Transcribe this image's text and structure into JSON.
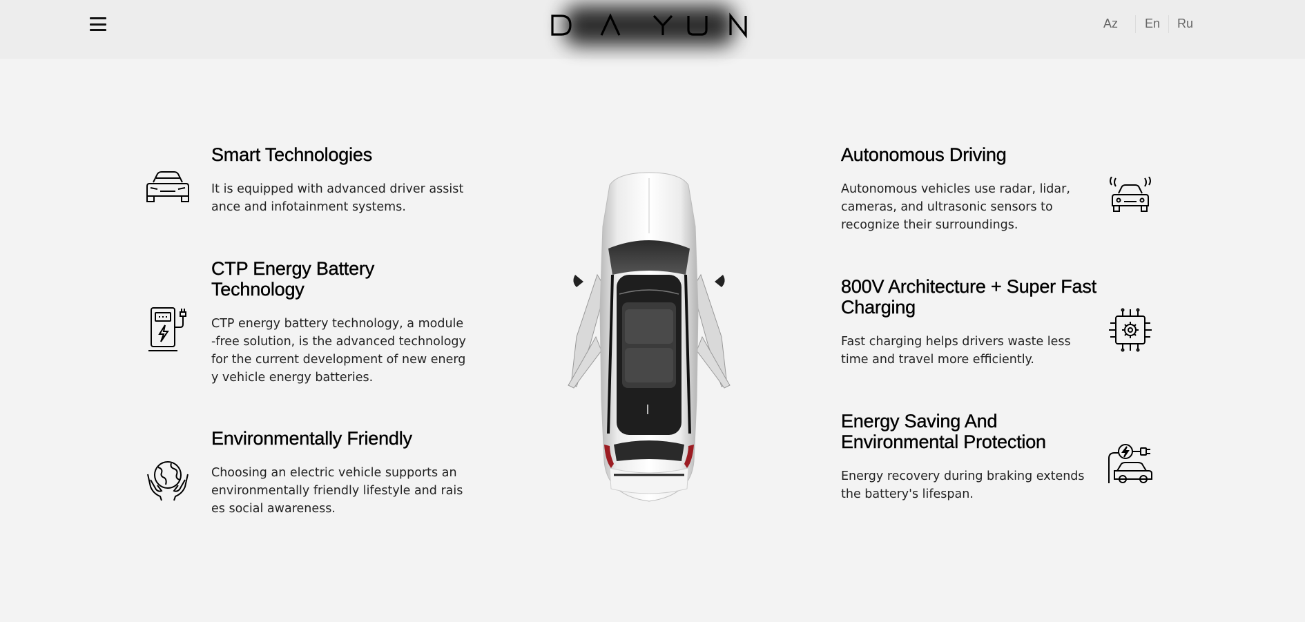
{
  "header": {
    "brand": "DAYUN",
    "languages": [
      "Az",
      "En",
      "Ru"
    ]
  },
  "features": {
    "left": [
      {
        "title": "Smart Technologies",
        "text": "It is equipped with advanced driver assistance and infotainment systems.",
        "icon": "car-front-icon"
      },
      {
        "title": "CTP Energy Battery Technology",
        "text": "CTP energy battery technology, a module-free solution, is the advanced technology for the current development of new energy vehicle energy batteries.",
        "icon": "charging-station-icon"
      },
      {
        "title": "Environmentally Friendly",
        "text": "Choosing an electric vehicle supports an environmentally friendly lifestyle and raises social awareness.",
        "icon": "globe-in-hands-icon"
      }
    ],
    "right": [
      {
        "title": "Autonomous Driving",
        "text": "Autonomous vehicles use radar, lidar, cameras, and ultrasonic sensors to recognize their surroundings.",
        "icon": "autonomous-car-icon"
      },
      {
        "title": "800V Architecture + Super Fast Charging",
        "text": "Fast charging helps drivers waste less time and travel more efficiently.",
        "icon": "chip-gear-icon"
      },
      {
        "title": "Energy Saving And Environmental Protection",
        "text": "Energy recovery during braking extends the battery's lifespan.",
        "icon": "electric-car-plug-icon"
      }
    ]
  }
}
